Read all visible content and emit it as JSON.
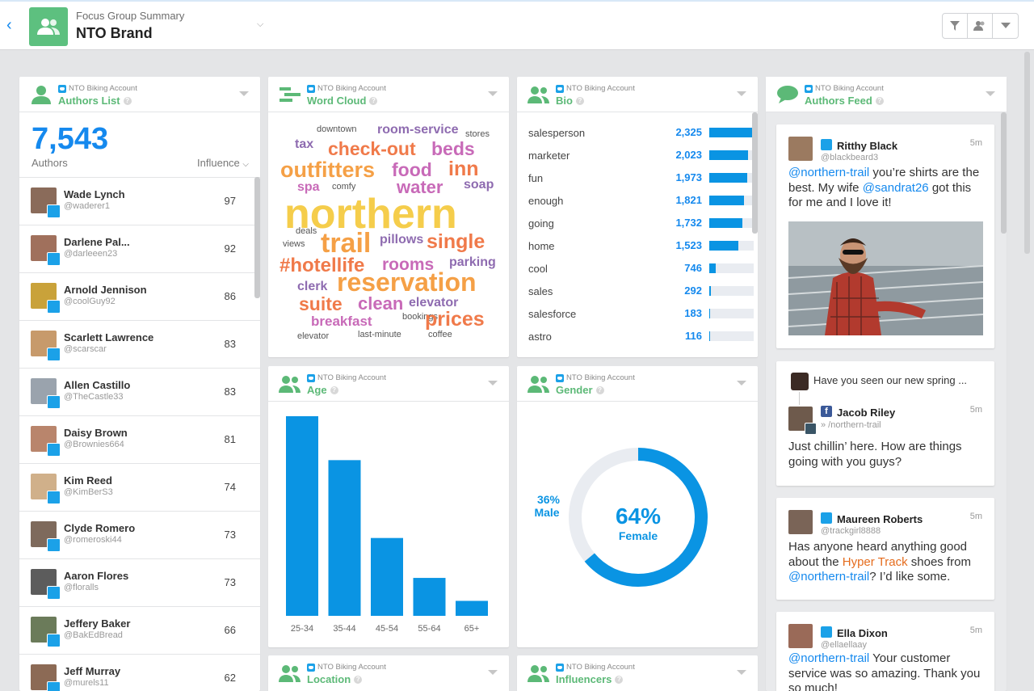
{
  "header": {
    "subtitle": "Focus Group Summary",
    "title": "NTO Brand"
  },
  "widgets": {
    "account": "NTO Biking Account",
    "authors_list": "Authors List",
    "word_cloud": "Word Cloud",
    "bio": "Bio",
    "authors_feed": "Authors Feed",
    "age": "Age",
    "gender": "Gender",
    "location": "Location",
    "influencers": "Influencers"
  },
  "authors": {
    "count": "7,543",
    "label": "Authors",
    "sort": "Influence",
    "rows": [
      {
        "name": "Wade Lynch",
        "handle": "@waderer1",
        "score": "97",
        "color": "#8a6b5a"
      },
      {
        "name": "Darlene Pal...",
        "handle": "@darleeen23",
        "score": "92",
        "color": "#a0705c"
      },
      {
        "name": "Arnold Jennison",
        "handle": "@coolGuy92",
        "score": "86",
        "color": "#c9a23a"
      },
      {
        "name": "Scarlett Lawrence",
        "handle": "@scarscar",
        "score": "83",
        "color": "#c79a6b"
      },
      {
        "name": "Allen Castillo",
        "handle": "@TheCastle33",
        "score": "83",
        "color": "#9aa3ad"
      },
      {
        "name": "Daisy Brown",
        "handle": "@Brownies664",
        "score": "81",
        "color": "#b9856c"
      },
      {
        "name": "Kim Reed",
        "handle": "@KimBerS3",
        "score": "74",
        "color": "#d0b08a"
      },
      {
        "name": "Clyde Romero",
        "handle": "@romeroski44",
        "score": "73",
        "color": "#7e6a5c"
      },
      {
        "name": "Aaron Flores",
        "handle": "@floralls",
        "score": "73",
        "color": "#5c5c5c"
      },
      {
        "name": "Jeffery Baker",
        "handle": "@BakEdBread",
        "score": "66",
        "color": "#6b7b5a"
      },
      {
        "name": "Jeff Murray",
        "handle": "@murels11",
        "score": "62",
        "color": "#8c6a55"
      }
    ]
  },
  "word_cloud_words": [
    {
      "w": "downtown",
      "c": "#555555",
      "s": 11
    },
    {
      "w": "room-service",
      "c": "#8e6bb0",
      "s": 16
    },
    {
      "w": "stores",
      "c": "#555555",
      "s": 11
    },
    {
      "w": "tax",
      "c": "#8e6bb0",
      "s": 16
    },
    {
      "w": "check-out",
      "c": "#f07a4a",
      "s": 23
    },
    {
      "w": "beds",
      "c": "#c86ab8",
      "s": 23
    },
    {
      "w": "outfitters",
      "c": "#f5a046",
      "s": 27
    },
    {
      "w": "food",
      "c": "#c86ab8",
      "s": 23
    },
    {
      "w": "inn",
      "c": "#f07a4a",
      "s": 25
    },
    {
      "w": "spa",
      "c": "#c86ab8",
      "s": 16
    },
    {
      "w": "comfy",
      "c": "#555555",
      "s": 11
    },
    {
      "w": "water",
      "c": "#c86ab8",
      "s": 22
    },
    {
      "w": "soap",
      "c": "#8e6bb0",
      "s": 16
    },
    {
      "w": "northern",
      "c": "#f5cd4b",
      "s": 52
    },
    {
      "w": "deals",
      "c": "#555555",
      "s": 11
    },
    {
      "w": "views",
      "c": "#555555",
      "s": 11
    },
    {
      "w": "trail",
      "c": "#f5a046",
      "s": 34
    },
    {
      "w": "pillows",
      "c": "#8e6bb0",
      "s": 16
    },
    {
      "w": "single",
      "c": "#f07a4a",
      "s": 25
    },
    {
      "w": "#hotellife",
      "c": "#f07a4a",
      "s": 24
    },
    {
      "w": "rooms",
      "c": "#c86ab8",
      "s": 21
    },
    {
      "w": "parking",
      "c": "#8e6bb0",
      "s": 16
    },
    {
      "w": "clerk",
      "c": "#8e6bb0",
      "s": 16
    },
    {
      "w": "reservation",
      "c": "#f5a046",
      "s": 32
    },
    {
      "w": "suite",
      "c": "#f07a4a",
      "s": 23
    },
    {
      "w": "clean",
      "c": "#c86ab8",
      "s": 22
    },
    {
      "w": "elevator",
      "c": "#8e6bb0",
      "s": 16
    },
    {
      "w": "breakfast",
      "c": "#c86ab8",
      "s": 17
    },
    {
      "w": "bookings",
      "c": "#555555",
      "s": 11
    },
    {
      "w": "prices",
      "c": "#f07a4a",
      "s": 25
    },
    {
      "w": "elevator",
      "c": "#555555",
      "s": 11
    },
    {
      "w": "last-minute",
      "c": "#555555",
      "s": 11
    },
    {
      "w": "coffee",
      "c": "#555555",
      "s": 11
    }
  ],
  "bio_rows": [
    {
      "word": "salesperson",
      "value": "2,325",
      "pct": 1.0
    },
    {
      "word": "marketer",
      "value": "2,023",
      "pct": 0.87
    },
    {
      "word": "fun",
      "value": "1,973",
      "pct": 0.85
    },
    {
      "word": "enough",
      "value": "1,821",
      "pct": 0.78
    },
    {
      "word": "going",
      "value": "1,732",
      "pct": 0.74
    },
    {
      "word": "home",
      "value": "1,523",
      "pct": 0.66
    },
    {
      "word": "cool",
      "value": "746",
      "pct": 0.14
    },
    {
      "word": "sales",
      "value": "292",
      "pct": 0.03
    },
    {
      "word": "salesforce",
      "value": "183",
      "pct": 0.02
    },
    {
      "word": "astro",
      "value": "116",
      "pct": 0.015
    }
  ],
  "chart_data": [
    {
      "type": "bar",
      "categories": [
        "25-34",
        "35-44",
        "45-54",
        "55-64",
        "65+"
      ],
      "values": [
        100,
        78,
        39,
        19,
        7.5
      ],
      "ylim": [
        0,
        100
      ],
      "color": "#0a94e3"
    },
    {
      "type": "pie",
      "labels": [
        "Female",
        "Male"
      ],
      "values": [
        64,
        36
      ],
      "female_pct": "64%",
      "female_label": "Female",
      "male_pct": "36%",
      "male_label": "Male",
      "colors": [
        "#0a94e3",
        "#e9ecf1"
      ]
    }
  ],
  "feed": [
    {
      "name": "Ritthy Black",
      "handle": "@blackbeard3",
      "time": "5m",
      "mention": "@northern-trail",
      "text1": " you’re shirts are the best. My wife ",
      "mention2": "@sandrat26",
      "text2": " got this for me and I love it!"
    },
    {
      "parent": "Have you seen our new spring ...",
      "name": "Jacob Riley",
      "handle": "» /northern-trail",
      "time": "5m",
      "text": "Just chillin’ here. How are things going with you guys?"
    },
    {
      "name": "Maureen Roberts",
      "handle": "@trackgirl8888",
      "time": "5m",
      "text1": "Has anyone heard anything good about the ",
      "highlight": "Hyper Track",
      "text2": " shoes from ",
      "mention": "@northern-trail",
      "text3": "? I’d like some."
    },
    {
      "name": "Ella Dixon",
      "handle": "@ellaellaay",
      "time": "5m",
      "mention": "@northern-trail",
      "text": " Your customer service was so amazing. Thank you so much!"
    }
  ]
}
